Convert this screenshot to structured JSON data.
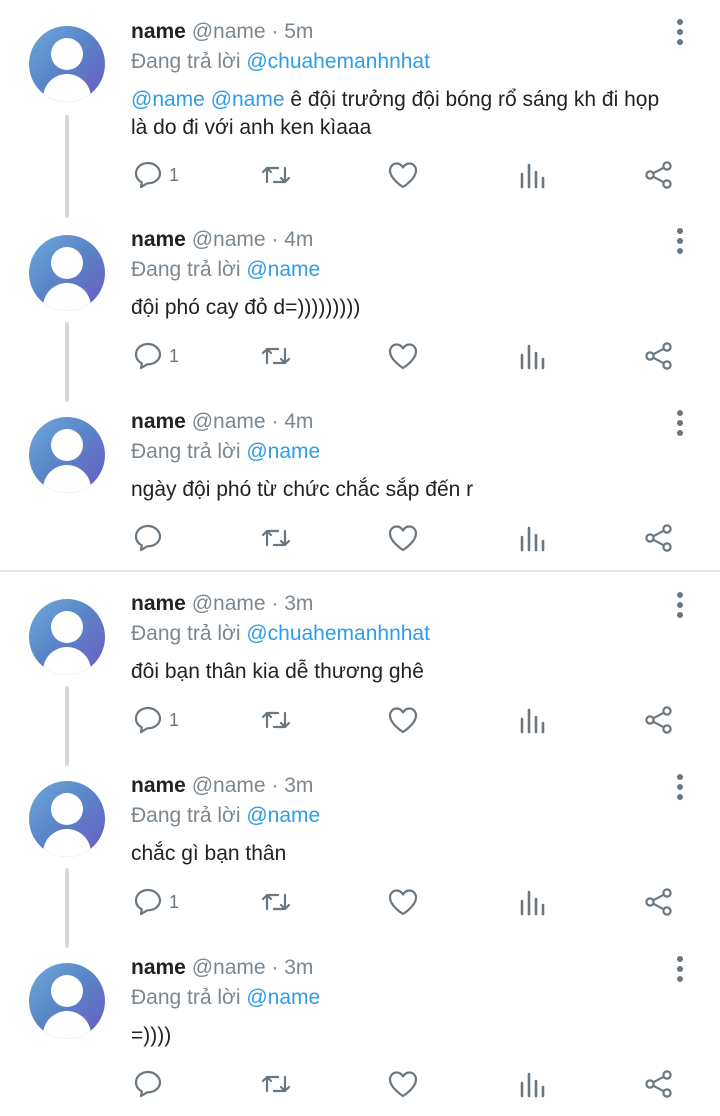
{
  "tweets": [
    {
      "name": "name",
      "handle": "@name",
      "time": "5m",
      "reply_prefix": "Đang trả lời",
      "reply_to": "@chuahemanhnhat",
      "mentions": "@name @name",
      "text_line1": " ê đội trưởng đội bóng rổ sáng kh đi họp",
      "text_line2": "là do đi với anh ken kìaaa",
      "reply_count": "1"
    },
    {
      "name": "name",
      "handle": "@name",
      "time": "4m",
      "reply_prefix": "Đang trả lời",
      "reply_to": "@name",
      "text": "đội phó cay đỏ d=)))))))))",
      "reply_count": "1"
    },
    {
      "name": "name",
      "handle": "@name",
      "time": "4m",
      "reply_prefix": "Đang trả lời",
      "reply_to": "@name",
      "text": "ngày đội phó từ chức chắc sắp đến r",
      "reply_count": ""
    },
    {
      "name": "name",
      "handle": "@name",
      "time": "3m",
      "reply_prefix": "Đang trả lời",
      "reply_to": "@chuahemanhnhat",
      "text": "đôi bạn thân kia dễ thương ghê",
      "reply_count": "1"
    },
    {
      "name": "name",
      "handle": "@name",
      "time": "3m",
      "reply_prefix": "Đang trả lời",
      "reply_to": "@name",
      "text": "chắc gì bạn thân",
      "reply_count": "1"
    },
    {
      "name": "name",
      "handle": "@name",
      "time": "3m",
      "reply_prefix": "Đang trả lời",
      "reply_to": "@name",
      "text": "=))))",
      "reply_count": ""
    }
  ],
  "icons": {
    "reply": "reply-icon",
    "retweet": "retweet-icon",
    "like": "heart-icon",
    "analytics": "analytics-icon",
    "share": "share-icon",
    "more": "more-options-icon",
    "avatar": "default-avatar-icon"
  },
  "colors": {
    "mention": "#2e9de6",
    "meta": "#7b8790",
    "icon": "#6b7780",
    "divider": "#e3e6e8",
    "thread_line": "#d4d8dc"
  }
}
